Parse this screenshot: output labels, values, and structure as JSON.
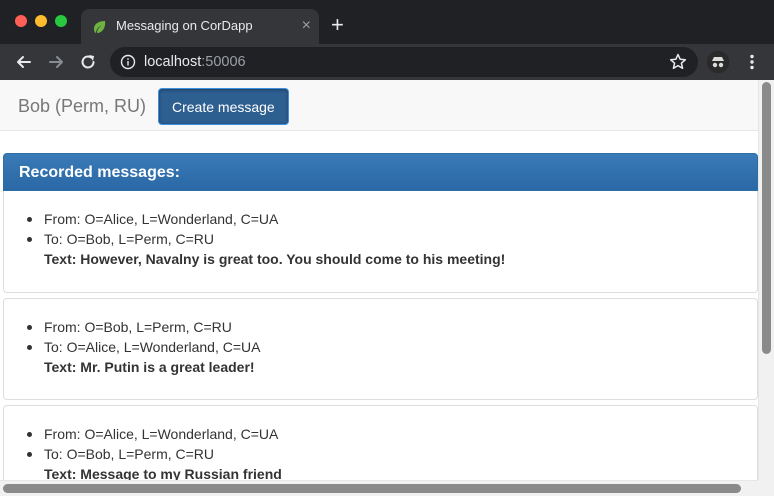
{
  "browser": {
    "tab_title": "Messaging on CorDapp",
    "tab_icon": "spring-leaf-icon",
    "new_tab_label": "+",
    "close_label": "×",
    "url_host": "localhost",
    "url_port": ":50006"
  },
  "navbar": {
    "brand": "Bob (Perm, RU)",
    "create_button": "Create message"
  },
  "panel": {
    "title": "Recorded messages:"
  },
  "messages": [
    {
      "from": "From: O=Alice, L=Wonderland, C=UA",
      "to": "To: O=Bob, L=Perm, C=RU",
      "text": "Text: However, Navalny is great too. You should come to his meeting!"
    },
    {
      "from": "From: O=Bob, L=Perm, C=RU",
      "to": "To: O=Alice, L=Wonderland, C=UA",
      "text": "Text: Mr. Putin is a great leader!"
    },
    {
      "from": "From: O=Alice, L=Wonderland, C=UA",
      "to": "To: O=Bob, L=Perm, C=RU",
      "text": "Text: Message to my Russian friend"
    }
  ],
  "colors": {
    "primary": "#2e6da4",
    "button": "#2e5f91",
    "chrome_dark": "#202124",
    "chrome_toolbar": "#35363a"
  }
}
